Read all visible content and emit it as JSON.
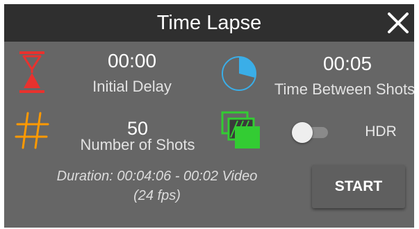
{
  "header": {
    "title": "Time Lapse"
  },
  "initial_delay": {
    "value": "00:00",
    "label": "Initial Delay"
  },
  "time_between_shots": {
    "value": "00:05",
    "label": "Time Between Shots"
  },
  "number_of_shots": {
    "value": "50",
    "label": "Number of Shots"
  },
  "hdr": {
    "label": "HDR",
    "enabled": false
  },
  "summary": {
    "line1": "Duration: 00:04:06 - 00:02 Video",
    "line2": "(24 fps)"
  },
  "actions": {
    "start_label": "START"
  },
  "icons": {
    "close": "close-icon",
    "hourglass": "hourglass-icon",
    "interval": "interval-pie-icon",
    "shots": "hash-icon",
    "hdr": "hdr-frames-icon"
  },
  "colors": {
    "header_bg": "#2f2f2f",
    "panel_bg": "#666666",
    "hourglass_red": "#e8322e",
    "interval_blue": "#3aaee8",
    "hash_orange": "#ff9900",
    "hdr_green": "#33cc33"
  }
}
